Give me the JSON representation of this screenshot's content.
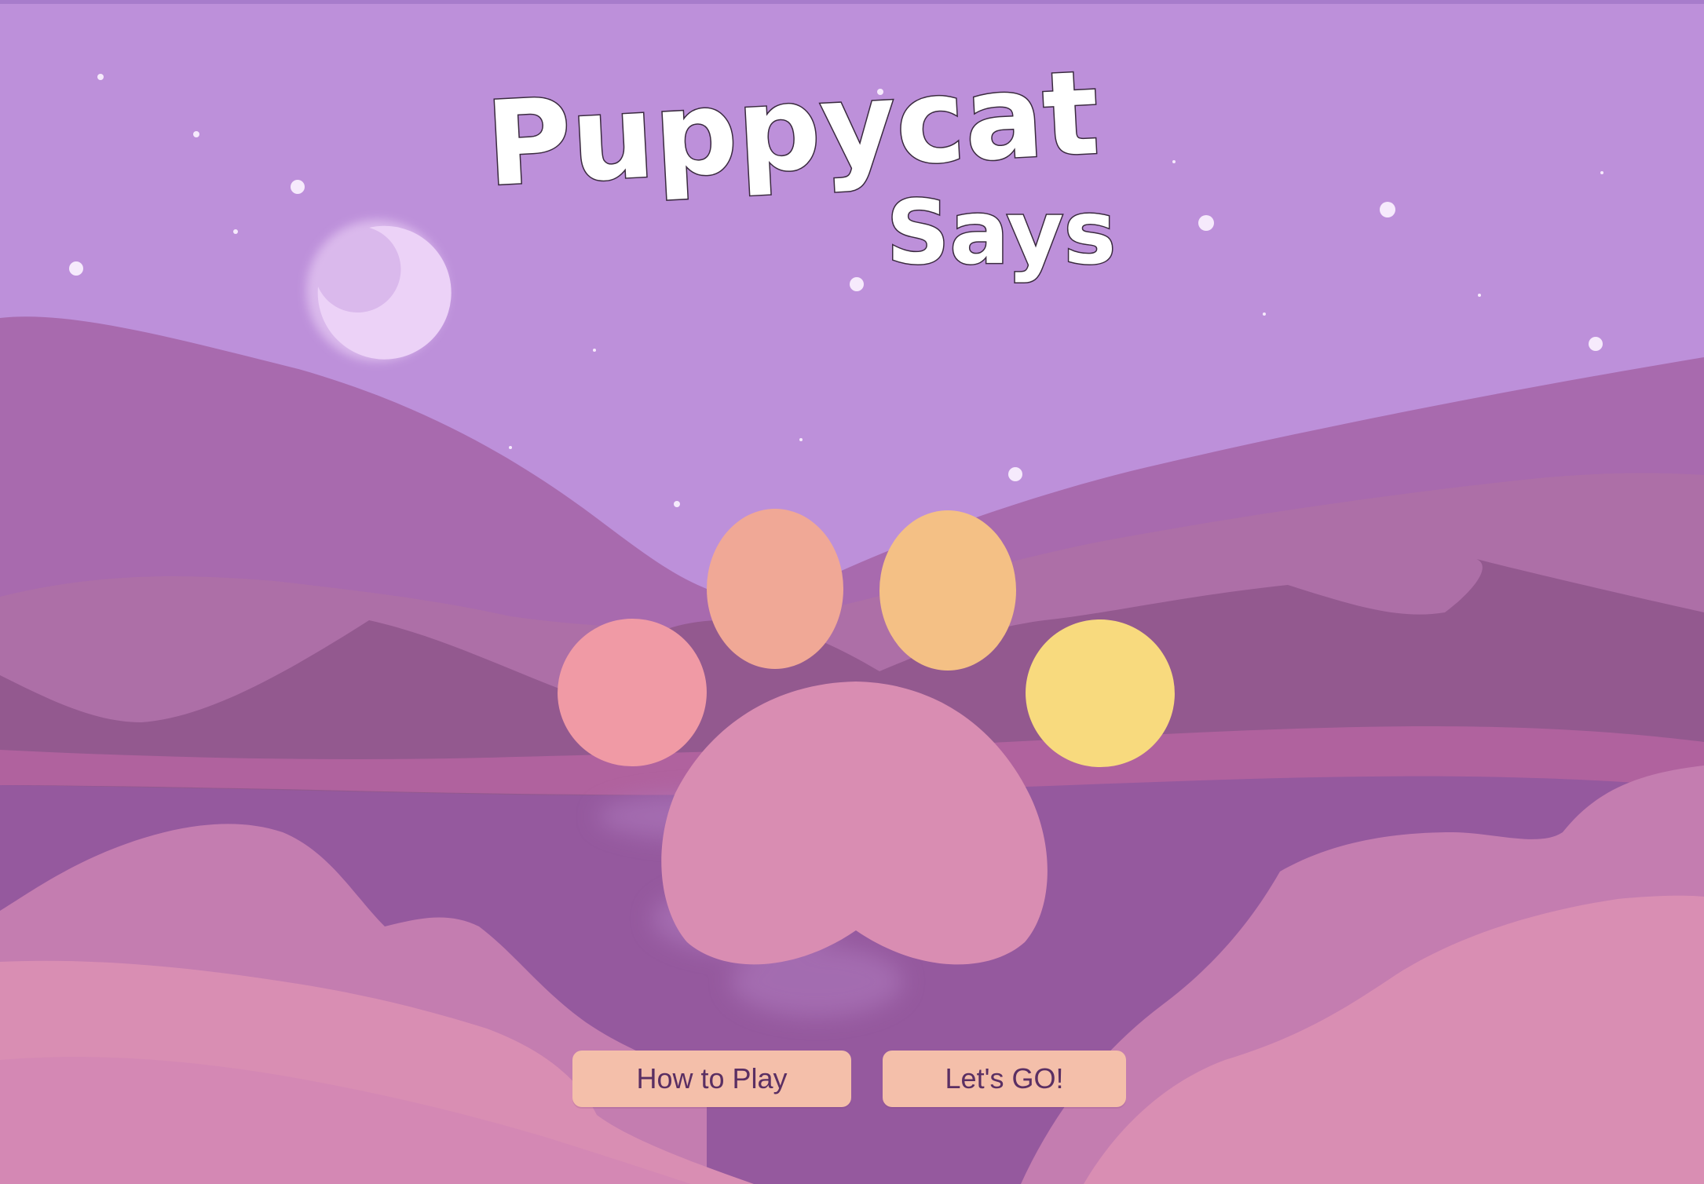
{
  "logo": {
    "line1": "Puppycat",
    "line2": "Says"
  },
  "menu": {
    "how_to_play_label": "How to Play",
    "lets_go_label": "Let's GO!"
  },
  "palette": {
    "sky": "#bd90da",
    "moon": "#ecd2f7",
    "toe_pink": "#f09aa5",
    "toe_salmon": "#f0a896",
    "toe_peach": "#f4c085",
    "toe_yellow": "#f8da7e",
    "paw_pad": "#d98db2",
    "button_bg": "#f4bfaa",
    "button_text": "#5a2f63"
  }
}
